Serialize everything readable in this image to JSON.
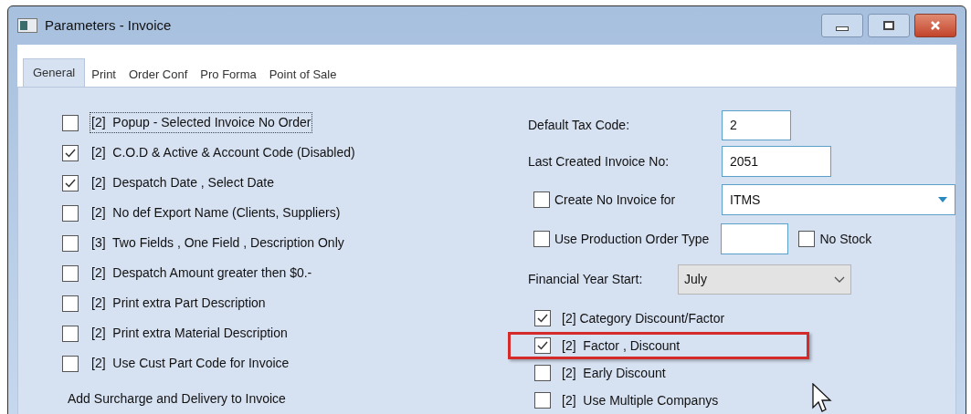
{
  "window": {
    "title": "Parameters - Invoice"
  },
  "tabs": [
    {
      "label": "General",
      "selected": true
    },
    {
      "label": "Print",
      "selected": false
    },
    {
      "label": "Order Conf",
      "selected": false
    },
    {
      "label": "Pro Forma",
      "selected": false
    },
    {
      "label": "Point of Sale",
      "selected": false
    }
  ],
  "left_options": [
    {
      "label": "[2]  Popup - Selected Invoice No Order",
      "checked": false,
      "focused": true
    },
    {
      "label": "[2]  C.O.D & Active & Account Code (Disabled)",
      "checked": true,
      "focused": false
    },
    {
      "label": "[2]  Despatch Date , Select Date",
      "checked": true,
      "focused": false
    },
    {
      "label": "[2]  No def Export Name (Clients, Suppliers)",
      "checked": false,
      "focused": false
    },
    {
      "label": "[3]  Two Fields , One Field , Description Only",
      "checked": false,
      "focused": false
    },
    {
      "label": "[2]  Despatch Amount greater then $0.-",
      "checked": false,
      "focused": false
    },
    {
      "label": "[2]  Print extra Part Description",
      "checked": false,
      "focused": false
    },
    {
      "label": "[2]  Print extra Material Description",
      "checked": false,
      "focused": false
    },
    {
      "label": "[2]  Use Cust Part Code for Invoice",
      "checked": false,
      "focused": false
    }
  ],
  "section_label": "Add Surcharge and Delivery to Invoice",
  "default_tax_code": {
    "label": "Default Tax Code:",
    "value": "2"
  },
  "last_created_invoice": {
    "label": "Last Created Invoice No:",
    "value": "2051"
  },
  "create_no_invoice": {
    "label": "Create No Invoice for",
    "checked": false,
    "value": "ITMS"
  },
  "production_order": {
    "label": "Use Production Order Type",
    "checked": false,
    "no_stock": {
      "label": "No Stock",
      "checked": false
    }
  },
  "financial_year_start": {
    "label": "Financial Year Start:",
    "value": "July"
  },
  "right_options": [
    {
      "label": "[2] Category Discount/Factor",
      "checked": true,
      "highlighted": false
    },
    {
      "label": "[2]  Factor , Discount",
      "checked": true,
      "highlighted": true
    },
    {
      "label": "[2]  Early Discount",
      "checked": false,
      "highlighted": false
    },
    {
      "label": "[2]  Use Multiple Companys",
      "checked": false,
      "highlighted": false
    }
  ]
}
